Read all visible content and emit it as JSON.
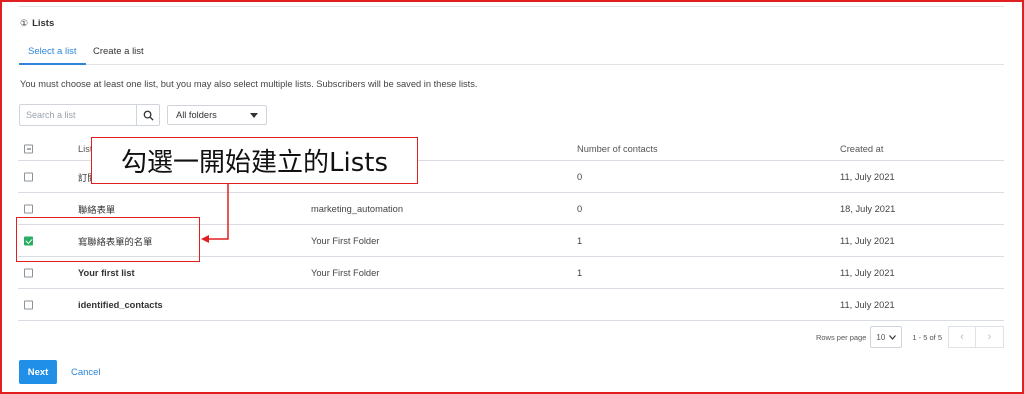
{
  "section": {
    "number": "①",
    "title": "Lists"
  },
  "tabs": [
    {
      "label": "Select a list",
      "active": true
    },
    {
      "label": "Create a list",
      "active": false
    }
  ],
  "help_text": "You must choose at least one list, but you may also select multiple lists. Subscribers will be saved in these lists.",
  "search": {
    "placeholder": "Search a list",
    "icon": "search-icon"
  },
  "folder_filter": {
    "selected": "All folders"
  },
  "table": {
    "headers": {
      "name": "Lists",
      "folder": "",
      "contacts": "Number of contacts",
      "created": "Created at"
    },
    "rows": [
      {
        "name": "訂閱",
        "folder": "",
        "contacts": "0",
        "created": "11, July 2021",
        "checked": false
      },
      {
        "name": "聯絡表單",
        "folder": "marketing_automation",
        "contacts": "0",
        "created": "18, July 2021",
        "checked": false
      },
      {
        "name": "寫聯絡表單的名單",
        "folder": "Your First Folder",
        "contacts": "1",
        "created": "11, July 2021",
        "checked": true
      },
      {
        "name": "Your first list",
        "folder": "Your First Folder",
        "contacts": "1",
        "created": "11, July 2021",
        "checked": false
      },
      {
        "name": "identified_contacts",
        "folder": "",
        "contacts": "",
        "created": "11, July 2021",
        "checked": false
      }
    ]
  },
  "pagination": {
    "rows_label": "Rows per page",
    "rows_value": "10",
    "range": "1 - 5 of 5"
  },
  "actions": {
    "next": "Next",
    "cancel": "Cancel"
  },
  "annotation": {
    "callout_text": "勾選一開始建立的Lists",
    "color": "#e02020"
  },
  "colors": {
    "accent": "#1f8fe8",
    "check": "#27ae60",
    "annotation": "#e02020"
  }
}
